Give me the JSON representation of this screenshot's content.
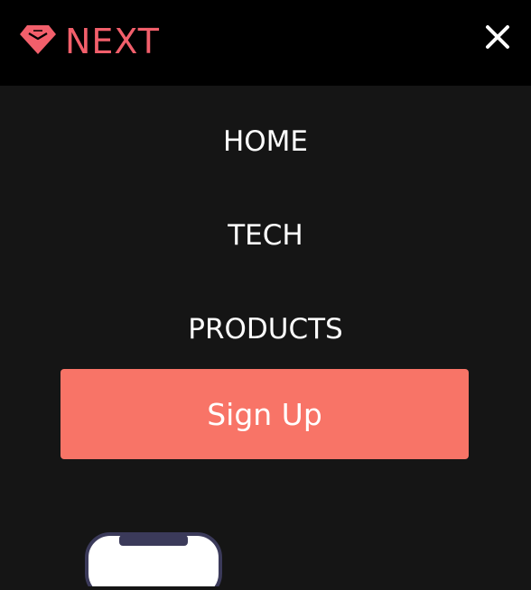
{
  "header": {
    "brand": "NEXT",
    "logo_icon": "diamond-icon",
    "close_icon": "close-icon",
    "accent": "#f25f6b"
  },
  "menu": {
    "items": [
      {
        "label": "HOME"
      },
      {
        "label": "TECH"
      },
      {
        "label": "PRODUCTS"
      }
    ],
    "signup_label": "Sign Up",
    "signup_color": "#f87467"
  },
  "illustration": {
    "icon": "phone-icon"
  }
}
